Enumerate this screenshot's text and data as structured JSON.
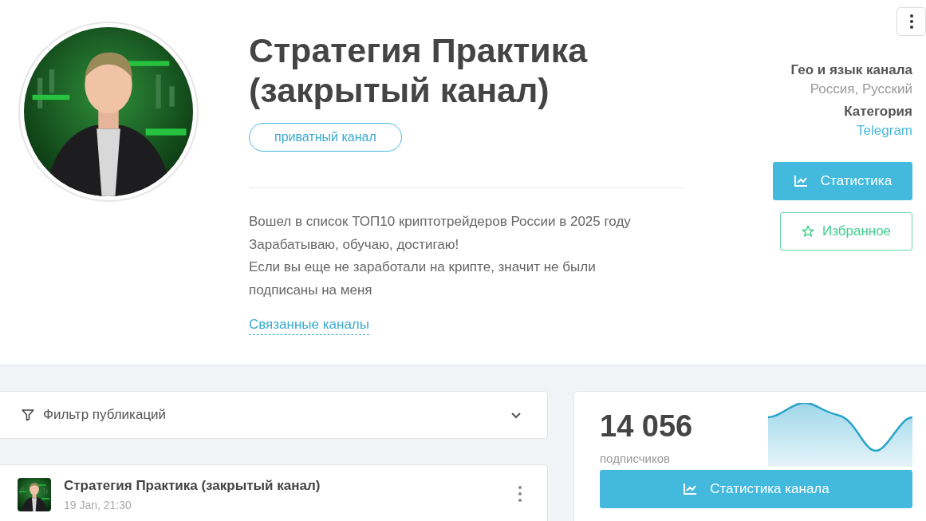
{
  "channel": {
    "title_lines": [
      "Стратегия Практика",
      "(закрытый канал)"
    ],
    "badge": "приватный канал",
    "description": [
      "Вошел в список ТОП10 криптотрейдеров России в 2025 году",
      "Зарабатываю, обучаю, достигаю!",
      "Если вы еще не заработали на крипте, значит не были",
      "подписаны на меня"
    ],
    "related_link": "Связанные каналы"
  },
  "info": [
    {
      "label": "Гео и язык канала",
      "value": "Россия, Русский",
      "kind": "text"
    },
    {
      "label": "Категория",
      "value": "Telegram",
      "kind": "link"
    }
  ],
  "actions": [
    {
      "label": "Статистика",
      "kind": "primary"
    },
    {
      "label": "Избранное",
      "kind": "outline"
    }
  ],
  "filter": {
    "label": "Фильтр публикаций",
    "expanded": false
  },
  "post": {
    "channel": "Стратегия Практика (закрытый канал)",
    "time": "19 Jan, 21:30"
  },
  "stats": {
    "count": "14 056",
    "caption": "подписчиков",
    "button": "Статистика канала"
  }
}
